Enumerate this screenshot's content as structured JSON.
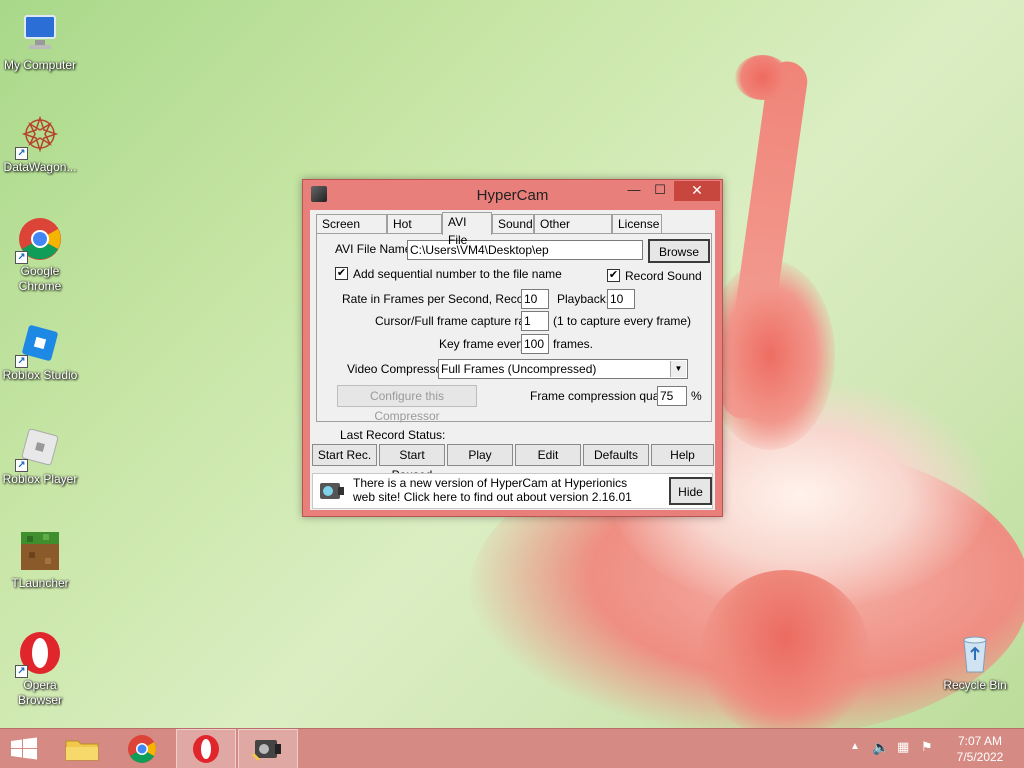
{
  "desktop": {
    "icons": [
      {
        "label": "My Computer",
        "icon": "computer-icon"
      },
      {
        "label": "DataWagon...",
        "icon": "datawagon-icon"
      },
      {
        "label": "Google Chrome",
        "icon": "chrome-icon"
      },
      {
        "label": "Roblox Studio",
        "icon": "roblox-studio-icon"
      },
      {
        "label": "Roblox Player",
        "icon": "roblox-player-icon"
      },
      {
        "label": "TLauncher",
        "icon": "tlauncher-icon"
      },
      {
        "label": "Opera Browser",
        "icon": "opera-icon"
      },
      {
        "label": "Recycle Bin",
        "icon": "recycle-bin-icon"
      }
    ]
  },
  "window": {
    "title": "HyperCam",
    "controls": {
      "minimize": "—",
      "maximize": "☐",
      "close": "✕"
    }
  },
  "tabs": [
    {
      "label": "Screen Area"
    },
    {
      "label": "Hot Keys"
    },
    {
      "label": "AVI File",
      "active": true
    },
    {
      "label": "Sound"
    },
    {
      "label": "Other Options"
    },
    {
      "label": "License"
    }
  ],
  "avi": {
    "file_name_label": "AVI File Name:",
    "file_name_value": "C:\\Users\\VM4\\Desktop\\ep",
    "browse_label": "Browse",
    "sequential_label": "Add sequential number to the file name",
    "sequential_checked": true,
    "record_sound_label": "Record Sound",
    "record_sound_checked": true,
    "rate_label": "Rate in Frames per Second,  Record:",
    "rate_record_value": "10",
    "playback_label": "Playback:",
    "playback_value": "10",
    "cursor_ratio_label": "Cursor/Full frame capture ratio",
    "cursor_ratio_value": "1",
    "cursor_ratio_hint": "(1 to capture every frame)",
    "keyframe_label": "Key frame every",
    "keyframe_value": "100",
    "keyframe_suffix": "frames.",
    "compressor_label": "Video Compressor:",
    "compressor_value": "Full Frames (Uncompressed)",
    "configure_label": "Configure this Compressor",
    "quality_label": "Frame compression quality",
    "quality_value": "75",
    "quality_unit": "%"
  },
  "status": {
    "label": "Last Record Status:"
  },
  "actions": [
    {
      "label": "Start Rec."
    },
    {
      "label": "Start Paused"
    },
    {
      "label": "Play"
    },
    {
      "label": "Edit"
    },
    {
      "label": "Defaults"
    },
    {
      "label": "Help"
    }
  ],
  "banner": {
    "text": "There is a new version of HyperCam at Hyperionics web site! Click here to find out about version 2.16.01",
    "hide_label": "Hide"
  },
  "taskbar": {
    "items": [
      "start-icon",
      "file-explorer-icon",
      "chrome-icon",
      "opera-icon",
      "hypercam-icon"
    ],
    "time": "7:07 AM",
    "date": "7/5/2022"
  },
  "colors": {
    "accent": "#e97f7a",
    "taskbar": "#d58b83",
    "close": "#c7463e"
  }
}
